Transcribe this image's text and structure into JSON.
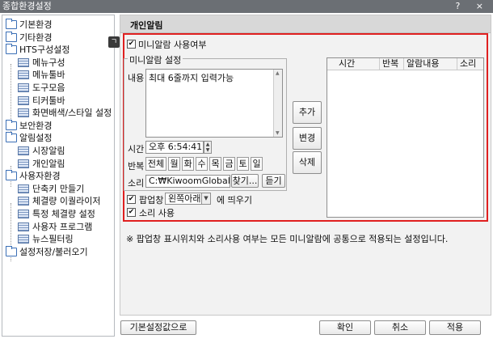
{
  "window": {
    "title": "종합환경설정",
    "help_label": "?",
    "close_label": "×"
  },
  "tree": [
    {
      "label": "기본환경",
      "type": "folder",
      "level": 0
    },
    {
      "label": "기타환경",
      "type": "folder",
      "level": 0
    },
    {
      "label": "HTS구성설정",
      "type": "folder",
      "level": 0
    },
    {
      "label": "메뉴구성",
      "type": "doc",
      "level": 1
    },
    {
      "label": "메뉴툴바",
      "type": "doc",
      "level": 1
    },
    {
      "label": "도구모음",
      "type": "doc",
      "level": 1
    },
    {
      "label": "티커툴바",
      "type": "doc",
      "level": 1
    },
    {
      "label": "화면배색/스타일 설정",
      "type": "doc",
      "level": 1
    },
    {
      "label": "보안환경",
      "type": "folder",
      "level": 0
    },
    {
      "label": "알림설정",
      "type": "folder",
      "level": 0
    },
    {
      "label": "시장알림",
      "type": "doc",
      "level": 1
    },
    {
      "label": "개인알림",
      "type": "doc",
      "level": 1
    },
    {
      "label": "사용자환경",
      "type": "folder",
      "level": 0
    },
    {
      "label": "단축키 만들기",
      "type": "doc",
      "level": 1
    },
    {
      "label": "체결량 이퀄라이저",
      "type": "doc",
      "level": 1
    },
    {
      "label": "특정 체결량 설정",
      "type": "doc",
      "level": 1
    },
    {
      "label": "사용자 프로그램",
      "type": "doc",
      "level": 1
    },
    {
      "label": "뉴스필터링",
      "type": "doc",
      "level": 1
    },
    {
      "label": "설정저장/불러오기",
      "type": "folder",
      "level": 0
    }
  ],
  "panel": {
    "title": "개인알림",
    "tip_icon": "ㄱ",
    "use_alarm": {
      "label": "미니알람 사용여부",
      "checked": true
    },
    "group_title": "미니알람 설정",
    "content_label": "내용",
    "content_value": "최대 6줄까지 입력가능",
    "time_label": "시간",
    "time_value": "오후  6:54:41",
    "repeat_label": "반복",
    "days": [
      "전체",
      "월",
      "화",
      "수",
      "목",
      "금",
      "토",
      "일"
    ],
    "sound_label": "소리",
    "sound_path": "C:₩KiwoomGlobal₩so",
    "find_button": "찾기...",
    "listen_button": "듣기",
    "popup_label": "팝업창",
    "popup_position": "왼쪽아래",
    "popup_suffix": "에 띄우기",
    "popup_checked": true,
    "sound_use_label": "소리 사용",
    "sound_use_checked": true,
    "add_button": "추가",
    "change_button": "변경",
    "delete_button": "삭제",
    "list_headers": [
      "시간",
      "반복",
      "알람내용",
      "소리"
    ],
    "note": "※ 팝업창 표시위치와 소리사용 여부는 모든 미니알람에 공통으로 적용되는 설정입니다."
  },
  "footer": {
    "default_button": "기본설정값으로",
    "ok_button": "확인",
    "cancel_button": "취소",
    "apply_button": "적용"
  }
}
